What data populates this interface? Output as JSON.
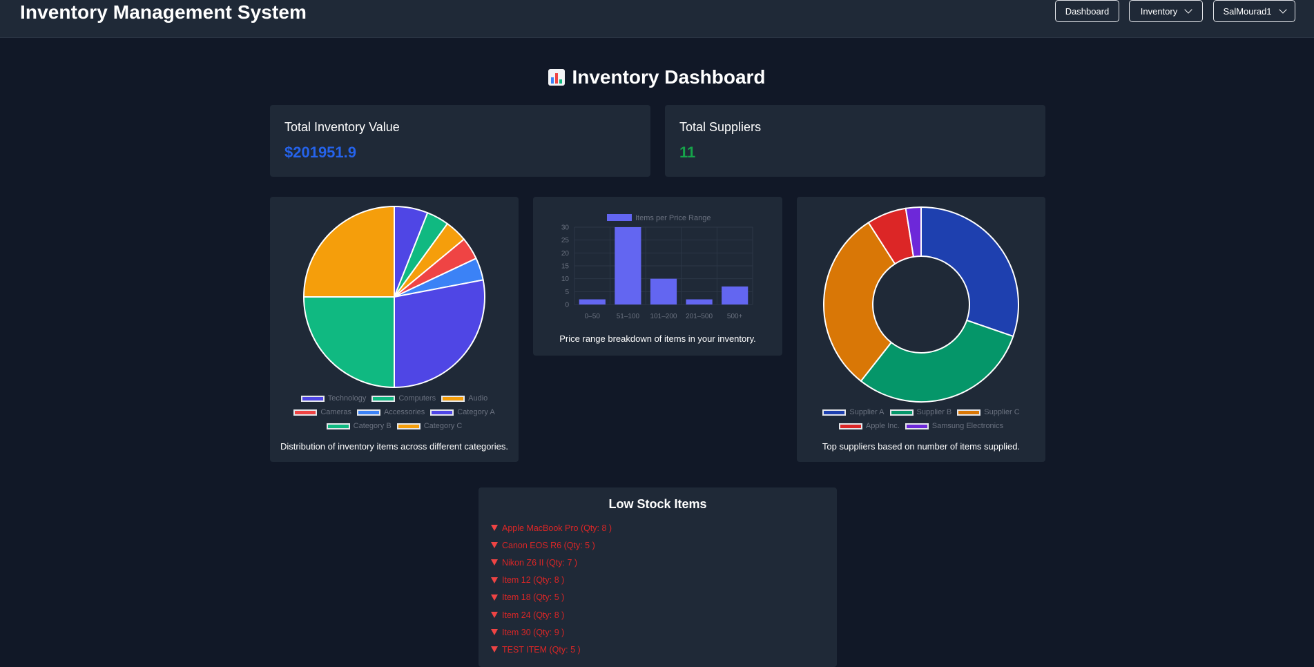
{
  "header": {
    "app_title": "Inventory Management System",
    "nav": {
      "dashboard": "Dashboard",
      "inventory": "Inventory",
      "user": "SalMourad1"
    }
  },
  "page_title": "Inventory Dashboard",
  "stats": {
    "total_value_label": "Total Inventory Value",
    "total_value": "$201951.9",
    "total_value_color": "#2563eb",
    "suppliers_label": "Total Suppliers",
    "suppliers": "11",
    "suppliers_color": "#16a34a"
  },
  "chart_data": [
    {
      "type": "pie",
      "categories": [
        "Technology",
        "Computers",
        "Audio",
        "Cameras",
        "Accessories",
        "Category A",
        "Category B",
        "Category C"
      ],
      "values": [
        6,
        4,
        4,
        4,
        4,
        28,
        25,
        25
      ],
      "colors": [
        "#4f46e5",
        "#10b981",
        "#f59e0b",
        "#ef4444",
        "#3b82f6",
        "#4f46e5",
        "#10b981",
        "#f59e0b"
      ],
      "caption": "Distribution of inventory items across different categories."
    },
    {
      "type": "bar",
      "categories": [
        "0–50",
        "51–100",
        "101–200",
        "201–500",
        "500+"
      ],
      "series": [
        {
          "name": "Items per Price Range",
          "values": [
            2,
            30,
            10,
            2,
            7
          ]
        }
      ],
      "ylim": [
        0,
        30
      ],
      "yticks": [
        0,
        5,
        10,
        15,
        20,
        25,
        30
      ],
      "color": "#6366f1",
      "grid": true,
      "legend": "top",
      "caption": "Price range breakdown of items in your inventory."
    },
    {
      "type": "pie",
      "subtype": "doughnut",
      "categories": [
        "Supplier A",
        "Supplier B",
        "Supplier C",
        "Apple Inc.",
        "Samsung Electronics"
      ],
      "values": [
        30,
        30,
        30,
        6.5,
        2.5
      ],
      "colors": [
        "#1e40af",
        "#059669",
        "#d97706",
        "#dc2626",
        "#6d28d9"
      ],
      "caption": "Top suppliers based on number of items supplied."
    }
  ],
  "low_stock": {
    "title": "Low Stock Items",
    "items": [
      "Apple MacBook Pro (Qty: 8 )",
      "Canon EOS R6 (Qty: 5 )",
      "Nikon Z6 II (Qty: 7 )",
      "Item 12 (Qty: 8 )",
      "Item 18 (Qty: 5 )",
      "Item 24 (Qty: 8 )",
      "Item 30 (Qty: 9 )",
      "TEST ITEM (Qty: 5 )"
    ]
  }
}
